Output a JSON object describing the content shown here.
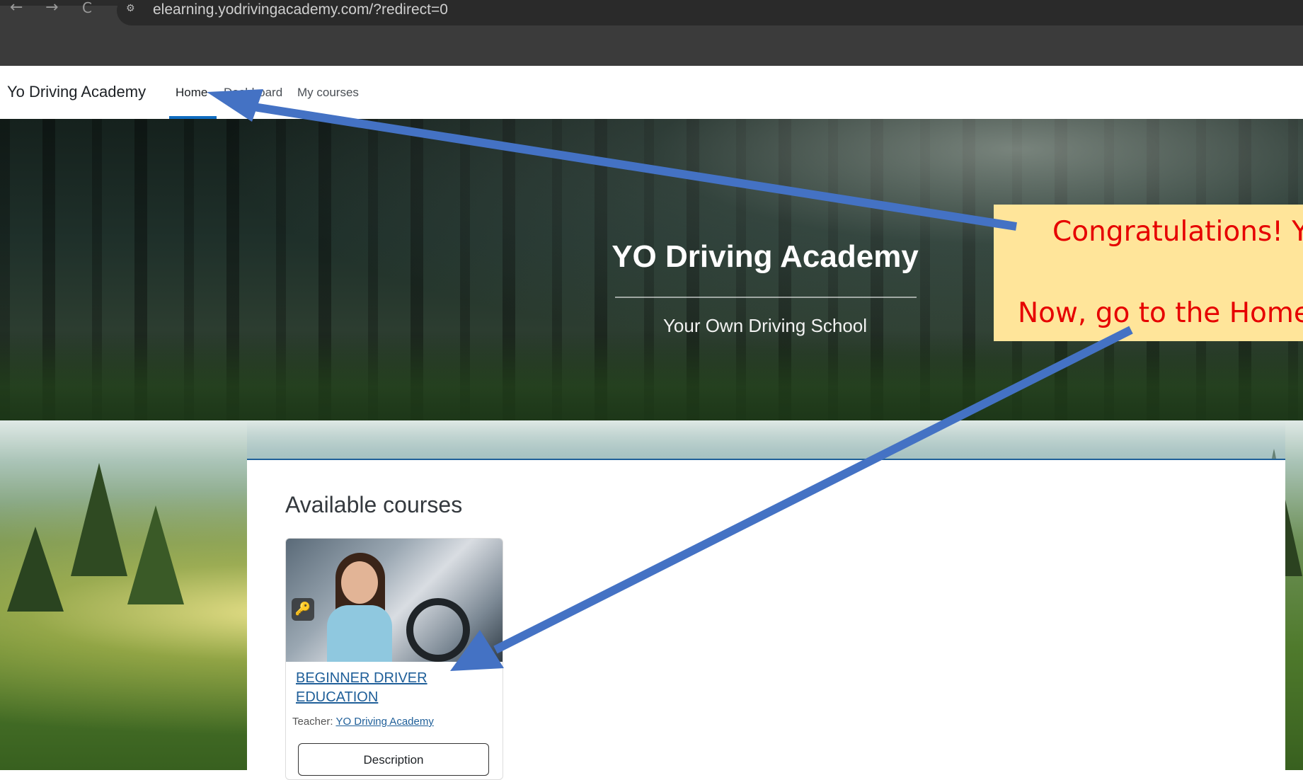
{
  "browser": {
    "back_glyph": "←",
    "forward_glyph": "→",
    "reload_glyph": "C",
    "site_info_glyph": "⚙",
    "url": "elearning.yodrivingacademy.com/?redirect=0"
  },
  "nav": {
    "brand": "Yo Driving Academy",
    "items": [
      {
        "label": "Home"
      },
      {
        "label": "Dashboard"
      },
      {
        "label": "My courses"
      }
    ]
  },
  "hero": {
    "title": "YO Driving Academy",
    "subtitle": "Your Own Driving School"
  },
  "main": {
    "section_title": "Available courses",
    "course": {
      "title": "BEGINNER DRIVER EDUCATION",
      "teacher_label": "Teacher:",
      "teacher_name": "YO Driving Academy",
      "key_glyph": "🔑",
      "button_label": "Description"
    }
  },
  "annotation": {
    "line1": "Congratulations! Y",
    "line2": "Now, go to the Home",
    "arrow_color": "#4472c4",
    "box_color": "#ffe59a",
    "text_color": "#e60000"
  },
  "colors": {
    "link": "#1f5f99",
    "accent": "#0f6cbf"
  }
}
